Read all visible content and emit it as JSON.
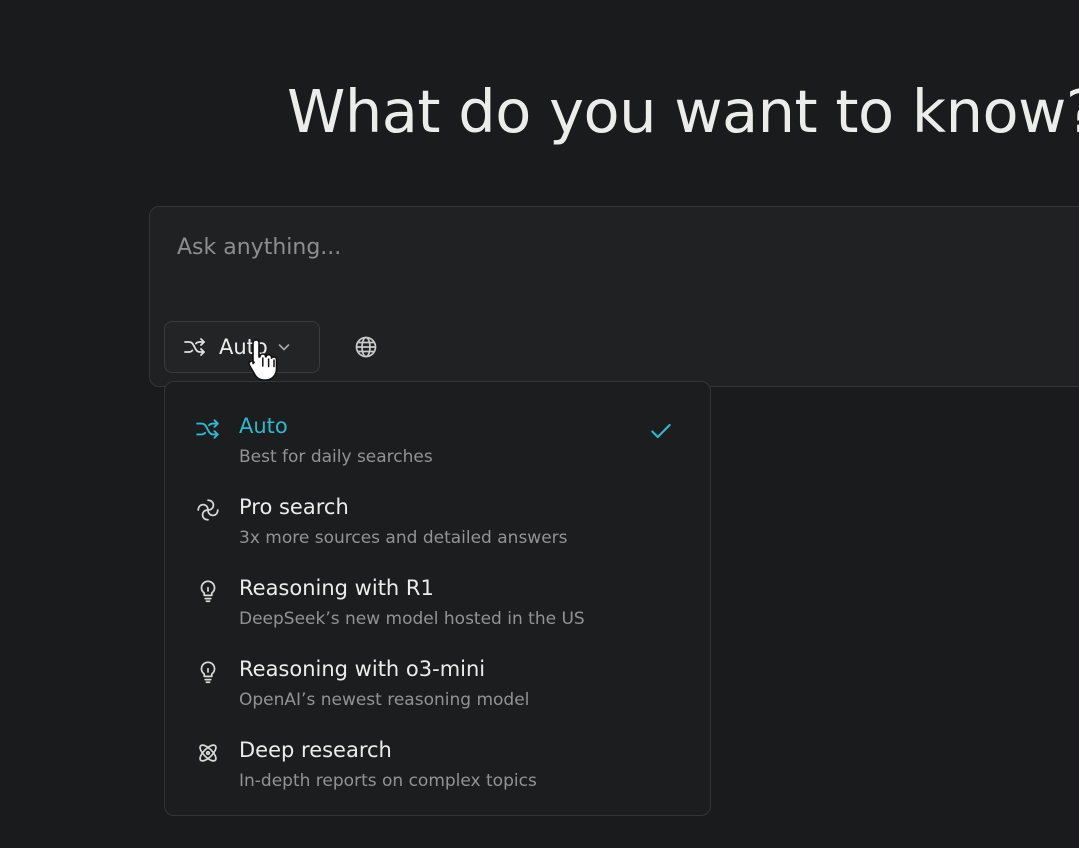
{
  "header": {
    "title": "What do you want to know?"
  },
  "search": {
    "placeholder": "Ask anything...",
    "value": ""
  },
  "mode_selector": {
    "label": "Auto",
    "icon": "shuffle-icon"
  },
  "globe_button": {
    "icon": "globe-icon"
  },
  "dropdown": {
    "options": [
      {
        "title": "Auto",
        "description": "Best for daily searches",
        "icon": "shuffle-icon",
        "selected": true
      },
      {
        "title": "Pro search",
        "description": "3x more sources and detailed answers",
        "icon": "pro-search-icon",
        "selected": false
      },
      {
        "title": "Reasoning with R1",
        "description": "DeepSeek’s new model hosted in the US",
        "icon": "lightbulb-icon",
        "selected": false
      },
      {
        "title": "Reasoning with o3-mini",
        "description": "OpenAI’s newest reasoning model",
        "icon": "lightbulb-icon",
        "selected": false
      },
      {
        "title": "Deep research",
        "description": "In-depth reports on complex topics",
        "icon": "atom-icon",
        "selected": false
      }
    ]
  },
  "colors": {
    "background": "#1a1b1c",
    "accent": "#2eb8c9",
    "text": "#ececea",
    "muted_text": "#929394"
  }
}
